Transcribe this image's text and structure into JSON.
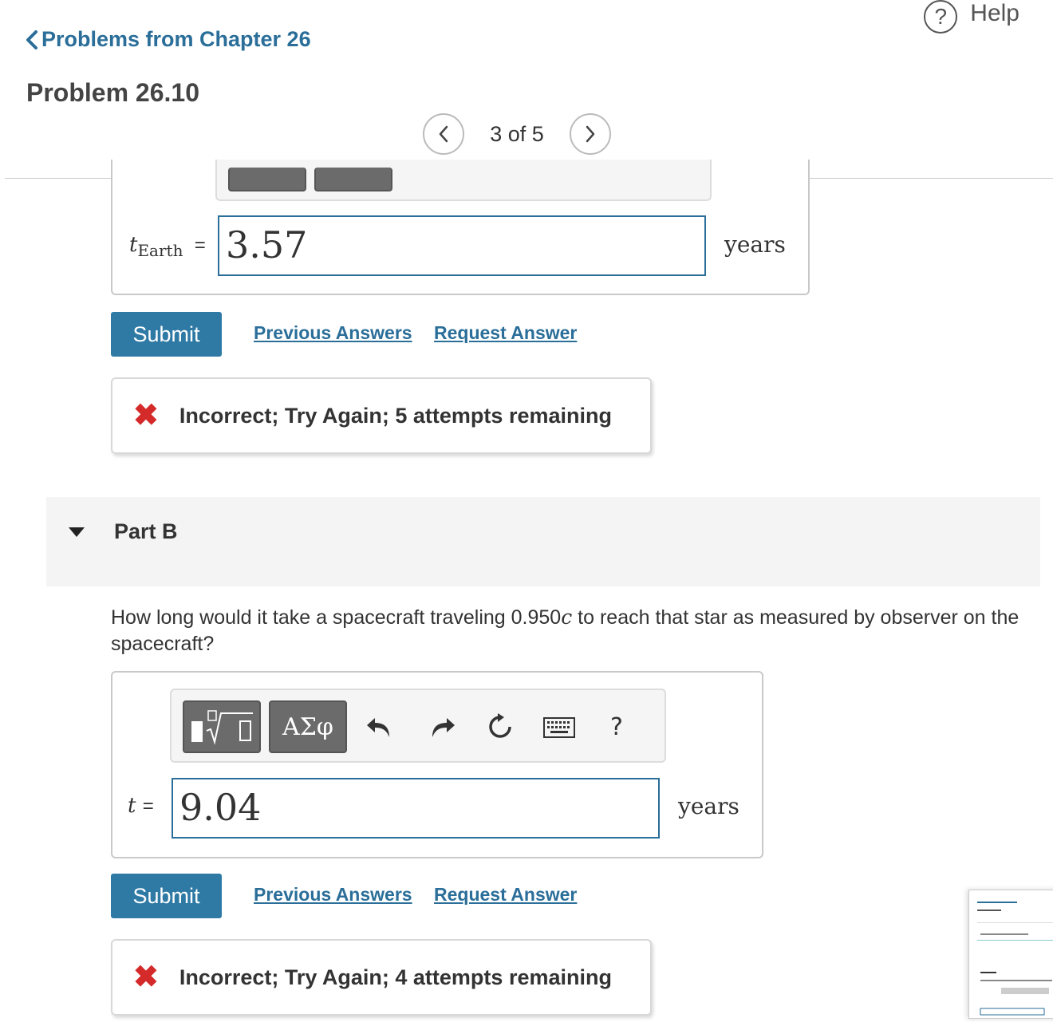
{
  "header": {
    "help_label": "Help",
    "help_symbol": "?",
    "back_label": "Problems from Chapter 26",
    "title": "Problem 26.10"
  },
  "pager": {
    "text": "3 of 5"
  },
  "partA": {
    "var_main": "t",
    "var_sub": "Earth",
    "equals": "=",
    "value": "3.57",
    "unit": "years",
    "submit_label": "Submit",
    "previous_answers_label": "Previous Answers",
    "request_answer_label": "Request Answer",
    "feedback": "Incorrect; Try Again; 5 attempts remaining"
  },
  "partB": {
    "label": "Part B",
    "question_pre": "How long would it take a spacecraft traveling 0.950",
    "question_c": "c",
    "question_post": " to reach that star as measured by observer on the spacecraft?",
    "toolbar": {
      "greek_label": "ΑΣφ",
      "help_label": "?"
    },
    "var": "t",
    "equals": "=",
    "value": "9.04",
    "unit": "years",
    "submit_label": "Submit",
    "previous_answers_label": "Previous Answers",
    "request_answer_label": "Request Answer",
    "feedback": "Incorrect; Try Again; 4 attempts remaining"
  },
  "colors": {
    "link": "#2a6e99",
    "submit": "#2f7aa5",
    "error": "#d42a2a"
  }
}
